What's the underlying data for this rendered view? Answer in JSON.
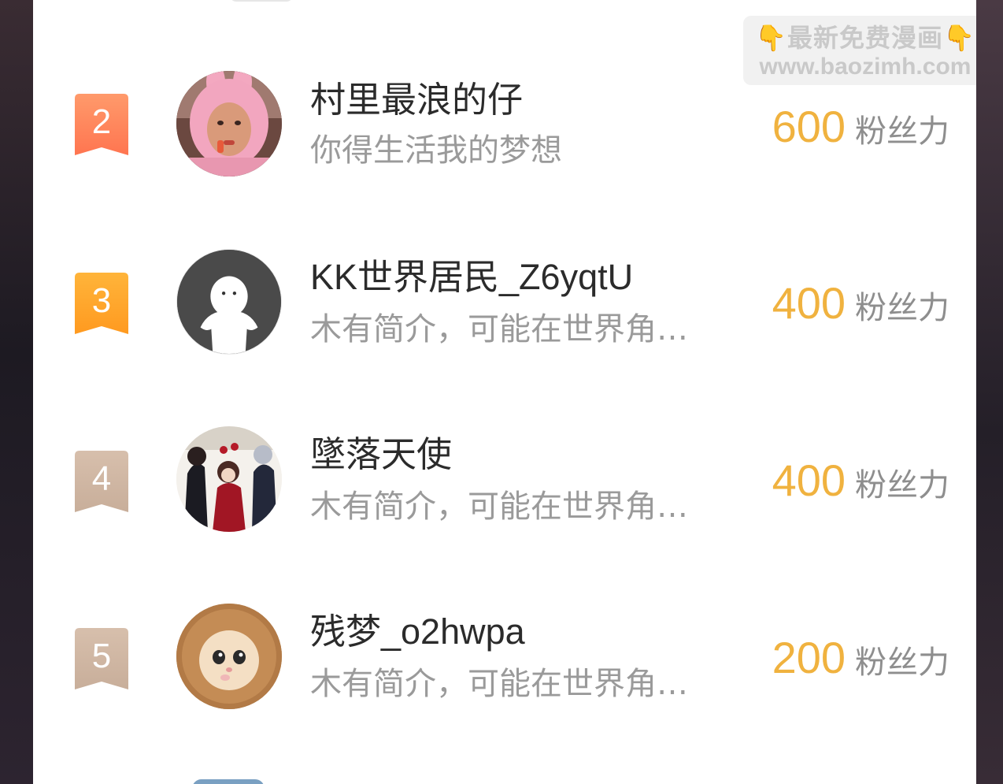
{
  "watermark": {
    "line1": "最新免费漫画",
    "line2": "www.baozimh.com",
    "hand_left": "👇",
    "hand_right": "👇"
  },
  "ranking": [
    {
      "rank": "2",
      "badge_color_top": "#ff9a6b",
      "badge_color_bottom": "#ff7550",
      "avatar": "pink-bunny-hat-photo",
      "name": "村里最浪的仔",
      "bio": "你得生活我的梦想",
      "score": "600",
      "unit": "粉丝力"
    },
    {
      "rank": "3",
      "badge_color_top": "#ffb43a",
      "badge_color_bottom": "#ff9a20",
      "avatar": "default-white-figure",
      "name": "KK世界居民_Z6yqtU",
      "bio": "木有简介，可能在世界角…",
      "score": "400",
      "unit": "粉丝力"
    },
    {
      "rank": "4",
      "badge_color_top": "#d7bfac",
      "badge_color_bottom": "#c8ae9a",
      "avatar": "anime-characters-illustration",
      "name": "墜落天使",
      "bio": "木有简介，可能在世界角…",
      "score": "400",
      "unit": "粉丝力"
    },
    {
      "rank": "5",
      "badge_color_top": "#d7bfac",
      "badge_color_bottom": "#c8ae9a",
      "avatar": "kitten-in-bread-hat",
      "name": "残梦_o2hwpa",
      "bio": "木有简介，可能在世界角…",
      "score": "200",
      "unit": "粉丝力"
    }
  ]
}
